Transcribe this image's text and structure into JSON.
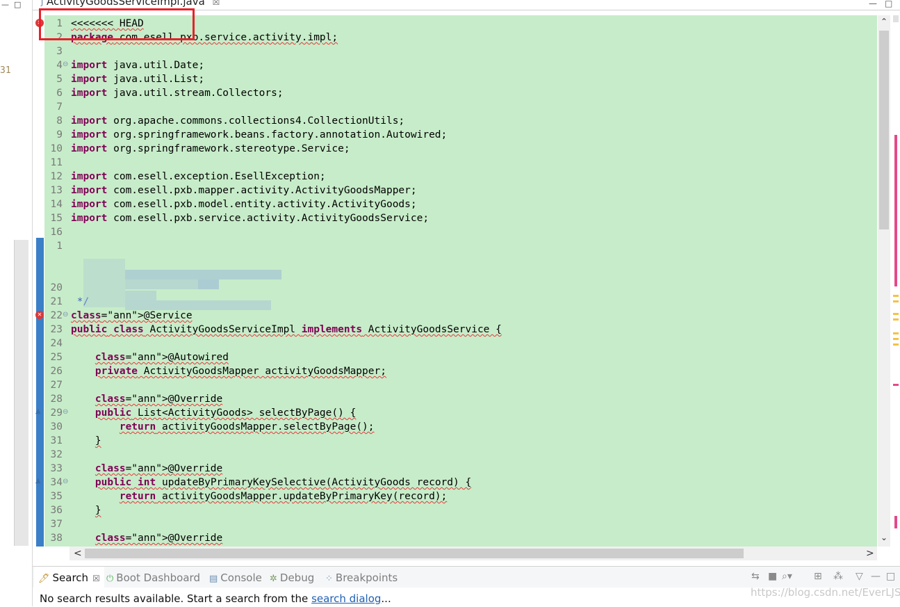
{
  "tab": {
    "title": "ActivityGoodsServiceImpl.java",
    "close": "☒"
  },
  "left_gutter_text": "31",
  "editor": {
    "lines": [
      {
        "n": "1",
        "text": "<<<<<<< HEAD",
        "marker": "error"
      },
      {
        "n": "2",
        "text": "package com.esell.pxb.service.activity.impl;"
      },
      {
        "n": "3",
        "text": ""
      },
      {
        "n": "4",
        "text": "import java.util.Date;",
        "fold": "⊖"
      },
      {
        "n": "5",
        "text": "import java.util.List;"
      },
      {
        "n": "6",
        "text": "import java.util.stream.Collectors;"
      },
      {
        "n": "7",
        "text": ""
      },
      {
        "n": "8",
        "text": "import org.apache.commons.collections4.CollectionUtils;"
      },
      {
        "n": "9",
        "text": "import org.springframework.beans.factory.annotation.Autowired;"
      },
      {
        "n": "10",
        "text": "import org.springframework.stereotype.Service;"
      },
      {
        "n": "11",
        "text": ""
      },
      {
        "n": "12",
        "text": "import com.esell.exception.EsellException;"
      },
      {
        "n": "13",
        "text": "import com.esell.pxb.mapper.activity.ActivityGoodsMapper;"
      },
      {
        "n": "14",
        "text": "import com.esell.pxb.model.entity.activity.ActivityGoods;"
      },
      {
        "n": "15",
        "text": "import com.esell.pxb.service.activity.ActivityGoodsService;"
      },
      {
        "n": "16",
        "text": ""
      },
      {
        "n": "1",
        "text": ""
      },
      {
        "n": "",
        "text": ""
      },
      {
        "n": "",
        "text": ""
      },
      {
        "n": "20",
        "text": ""
      },
      {
        "n": "21",
        "text": " */"
      },
      {
        "n": "22",
        "text": "@Service",
        "marker": "error",
        "fold": "⊖"
      },
      {
        "n": "23",
        "text": "public class ActivityGoodsServiceImpl implements ActivityGoodsService {"
      },
      {
        "n": "24",
        "text": ""
      },
      {
        "n": "25",
        "text": "    @Autowired"
      },
      {
        "n": "26",
        "text": "    private ActivityGoodsMapper activityGoodsMapper;"
      },
      {
        "n": "27",
        "text": ""
      },
      {
        "n": "28",
        "text": "    @Override"
      },
      {
        "n": "29",
        "text": "    public List<ActivityGoods> selectByPage() {",
        "marker": "override",
        "fold": "⊖"
      },
      {
        "n": "30",
        "text": "        return activityGoodsMapper.selectByPage();"
      },
      {
        "n": "31",
        "text": "    }"
      },
      {
        "n": "32",
        "text": ""
      },
      {
        "n": "33",
        "text": "    @Override"
      },
      {
        "n": "34",
        "text": "    public int updateByPrimaryKeySelective(ActivityGoods record) {",
        "marker": "override",
        "fold": "⊖"
      },
      {
        "n": "35",
        "text": "        return activityGoodsMapper.updateByPrimaryKey(record);"
      },
      {
        "n": "36",
        "text": "    }"
      },
      {
        "n": "37",
        "text": ""
      },
      {
        "n": "38",
        "text": "    @Override"
      }
    ]
  },
  "bottom_panel": {
    "tabs": [
      {
        "label": "Search",
        "icon": "search-icon",
        "active": true
      },
      {
        "label": "Boot Dashboard",
        "icon": "boot-dashboard-icon"
      },
      {
        "label": "Console",
        "icon": "console-icon"
      },
      {
        "label": "Debug",
        "icon": "debug-icon"
      },
      {
        "label": "Breakpoints",
        "icon": "breakpoints-icon"
      }
    ],
    "message_prefix": "No search results available. Start a search from the ",
    "message_link": "search dialog",
    "message_suffix": "..."
  },
  "watermark": "https://blog.csdn.net/EverLJS",
  "colors": {
    "editor_bg": "#c7ecc9",
    "keyword": "#7f0055",
    "annotation": "#646464",
    "comment": "#3f5fbf",
    "highlight_box": "#e8202a",
    "link": "#1f5fb4"
  }
}
